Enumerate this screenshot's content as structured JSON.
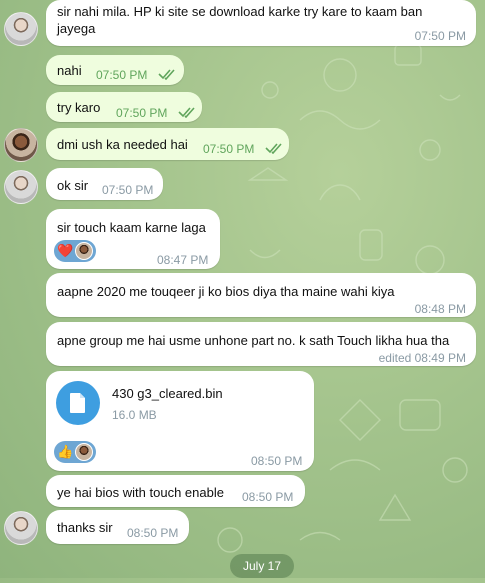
{
  "messages": [
    {
      "text": "sir nahi mila. HP ki site se download karke try kare to kaam ban jayega",
      "time": "07:50 PM"
    },
    {
      "text": "nahi",
      "time": "07:50 PM"
    },
    {
      "text": "try karo",
      "time": "07:50 PM"
    },
    {
      "text": "dmi ush ka needed hai",
      "time": "07:50 PM"
    },
    {
      "text": "ok sir",
      "time": "07:50 PM"
    },
    {
      "text": "sir touch kaam karne laga",
      "time": "08:47 PM",
      "reaction": "❤️"
    },
    {
      "text": "aapne 2020 me touqeer ji ko bios diya tha maine wahi kiya",
      "time": "08:48 PM"
    },
    {
      "text": "apne group me hai usme unhone part no. k sath Touch likha hua tha",
      "time": "edited 08:49 PM"
    },
    {
      "time": "08:50 PM",
      "reaction": "👍"
    },
    {
      "text": "ye hai bios with touch enable",
      "time": "08:50 PM"
    },
    {
      "text": "thanks sir",
      "time": "08:50 PM"
    }
  ],
  "file": {
    "name": "430 g3_cleared.bin",
    "size": "16.0 MB"
  },
  "date_pill": "July 17",
  "colors": {
    "incoming": "#ffffff",
    "outgoing": "#effdde",
    "accent": "#3e9ee0",
    "read_check": "#60a55c"
  }
}
